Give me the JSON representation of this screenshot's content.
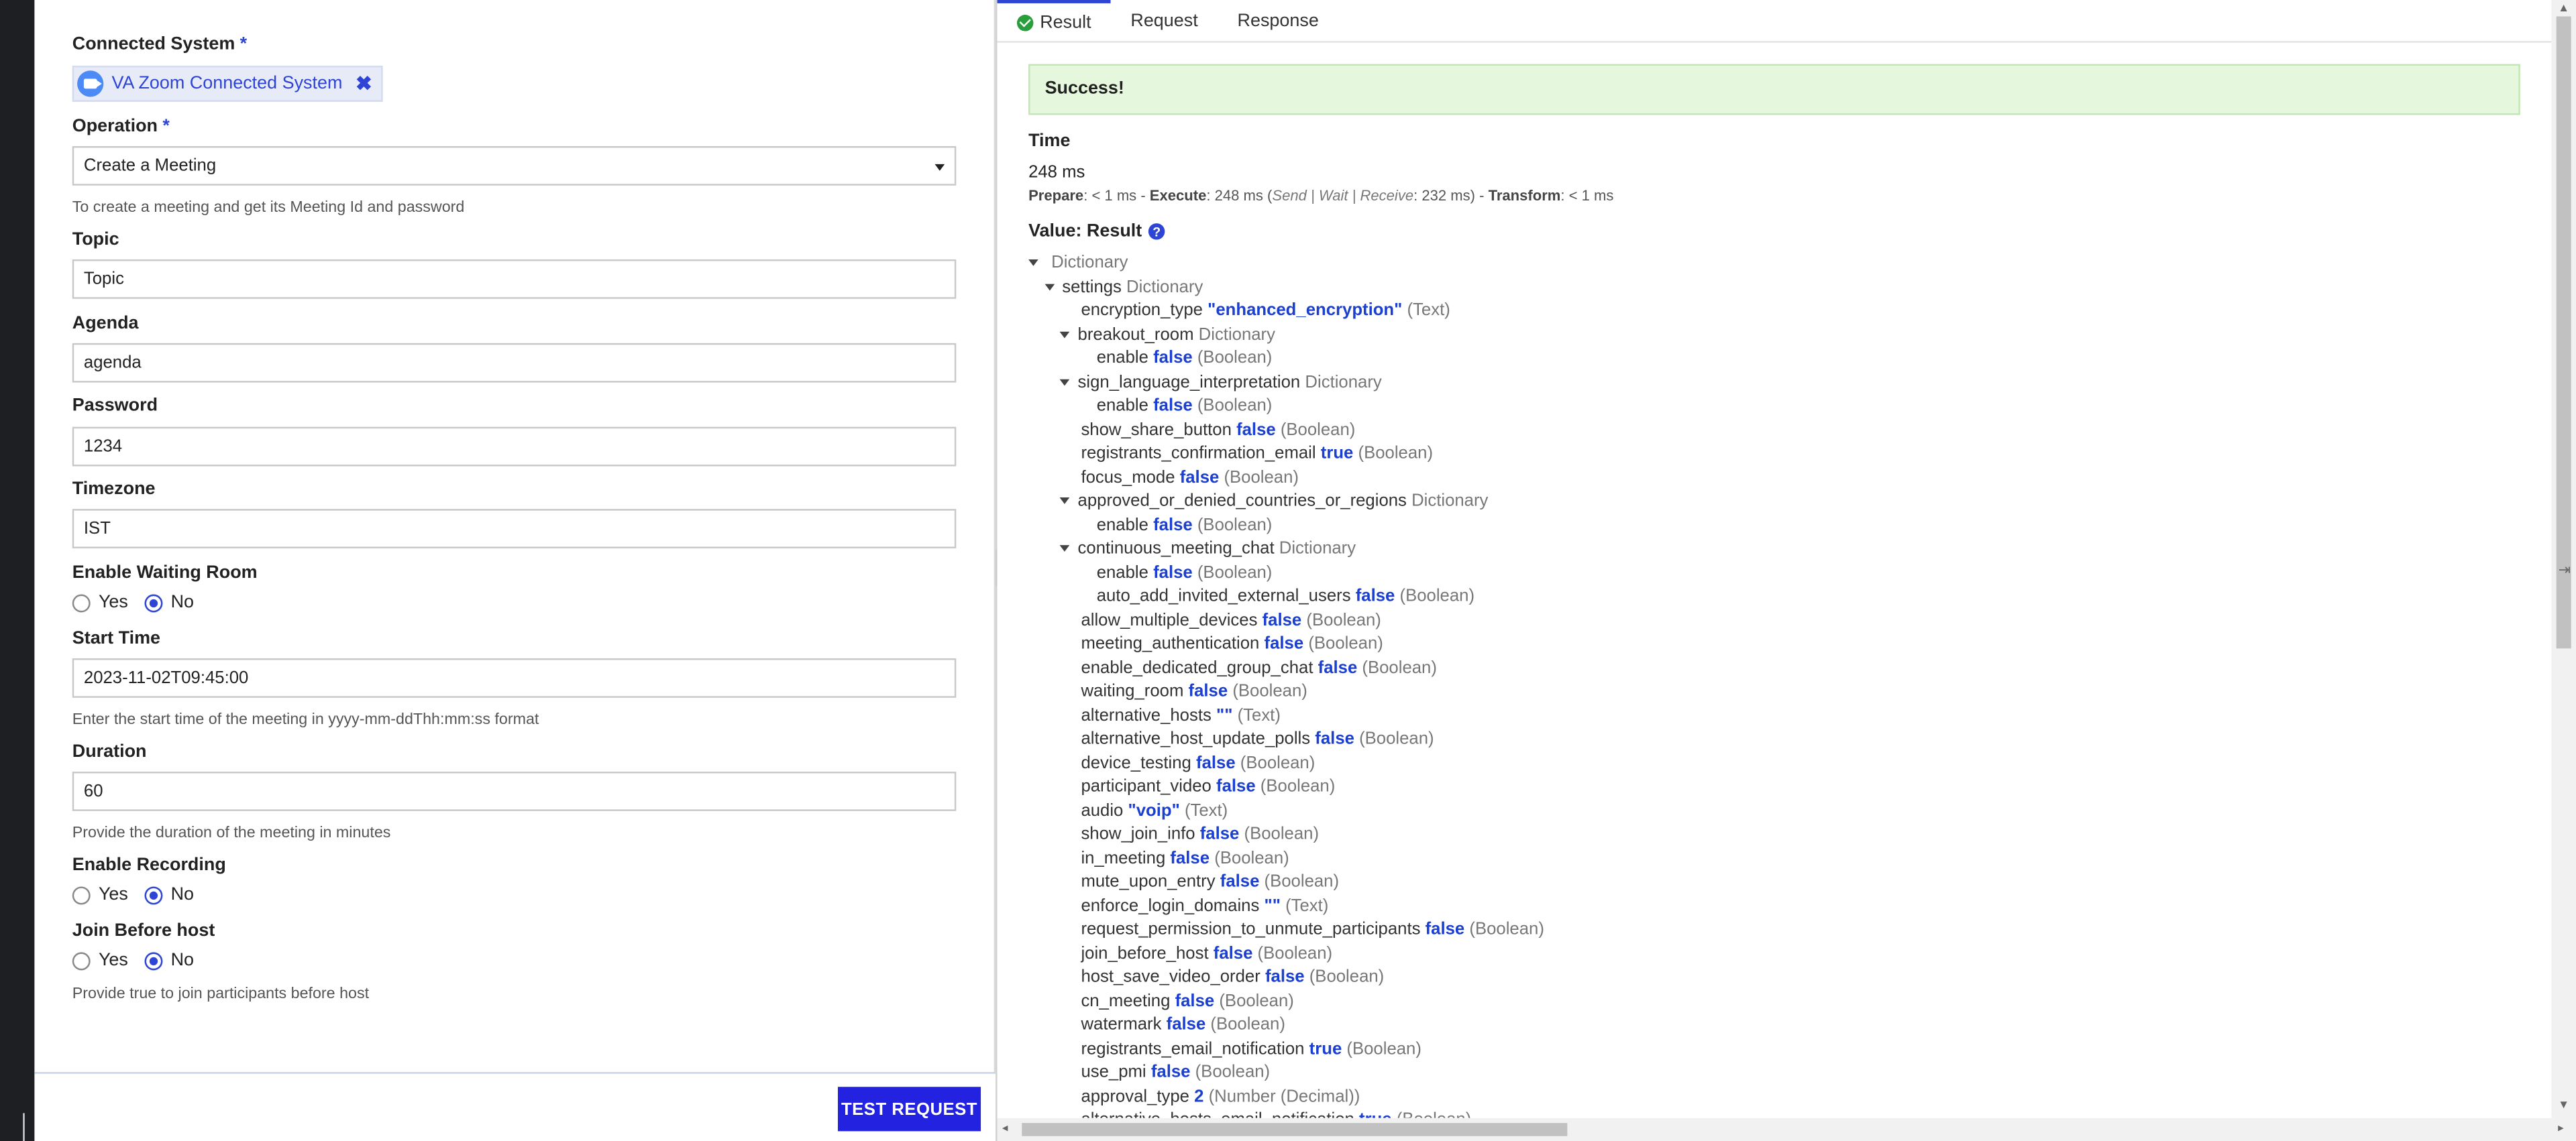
{
  "form": {
    "connected_system": {
      "label": "Connected System",
      "required_mark": "*",
      "chip_text": "VA Zoom Connected System",
      "chip_remove": "✖"
    },
    "operation": {
      "label": "Operation",
      "required_mark": "*",
      "value": "Create a Meeting",
      "helper": "To create a meeting and get its Meeting Id and password"
    },
    "topic": {
      "label": "Topic",
      "value": "Topic"
    },
    "agenda": {
      "label": "Agenda",
      "value": "agenda"
    },
    "password": {
      "label": "Password",
      "value": "1234"
    },
    "timezone": {
      "label": "Timezone",
      "value": "IST"
    },
    "waiting_room": {
      "label": "Enable Waiting Room",
      "yes": "Yes",
      "no": "No",
      "selected": "No"
    },
    "start_time": {
      "label": "Start Time",
      "value": "2023-11-02T09:45:00",
      "helper": "Enter the start time of the meeting in yyyy-mm-ddThh:mm:ss format"
    },
    "duration": {
      "label": "Duration",
      "value": "60",
      "helper": "Provide the duration of the meeting in minutes"
    },
    "recording": {
      "label": "Enable Recording",
      "yes": "Yes",
      "no": "No",
      "selected": "No"
    },
    "join_before_host": {
      "label": "Join Before host",
      "yes": "Yes",
      "no": "No",
      "selected": "No",
      "helper": "Provide true to join participants before host"
    }
  },
  "footer": {
    "test_button": "TEST REQUEST"
  },
  "tabs": {
    "result": "Result",
    "request": "Request",
    "response": "Response"
  },
  "result": {
    "banner": "Success!",
    "time_label": "Time",
    "time_value": "248 ms",
    "timing": {
      "prepare_label": "Prepare",
      "prepare_value": ": < 1 ms - ",
      "execute_label": "Execute",
      "execute_value": ": 248 ms (",
      "swr_label": "Send | Wait | Receive",
      "swr_value": ": 232 ms) - ",
      "transform_label": "Transform",
      "transform_value": ": < 1 ms"
    },
    "value_label": "Value: Result",
    "help_glyph": "?"
  },
  "tree": [
    {
      "key": "",
      "type": "Dictionary",
      "collapsible": true
    },
    {
      "key": "settings",
      "type": "Dictionary",
      "collapsible": true
    },
    {
      "key": "encryption_type",
      "value": "\"enhanced_encryption\"",
      "type": "(Text)"
    },
    {
      "key": "breakout_room",
      "type": "Dictionary",
      "collapsible": true
    },
    {
      "key": "enable",
      "value": "false",
      "type": "(Boolean)"
    },
    {
      "key": "sign_language_interpretation",
      "type": "Dictionary",
      "collapsible": true
    },
    {
      "key": "enable",
      "value": "false",
      "type": "(Boolean)"
    },
    {
      "key": "show_share_button",
      "value": "false",
      "type": "(Boolean)"
    },
    {
      "key": "registrants_confirmation_email",
      "value": "true",
      "type": "(Boolean)"
    },
    {
      "key": "focus_mode",
      "value": "false",
      "type": "(Boolean)"
    },
    {
      "key": "approved_or_denied_countries_or_regions",
      "type": "Dictionary",
      "collapsible": true
    },
    {
      "key": "enable",
      "value": "false",
      "type": "(Boolean)"
    },
    {
      "key": "continuous_meeting_chat",
      "type": "Dictionary",
      "collapsible": true
    },
    {
      "key": "enable",
      "value": "false",
      "type": "(Boolean)"
    },
    {
      "key": "auto_add_invited_external_users",
      "value": "false",
      "type": "(Boolean)"
    },
    {
      "key": "allow_multiple_devices",
      "value": "false",
      "type": "(Boolean)"
    },
    {
      "key": "meeting_authentication",
      "value": "false",
      "type": "(Boolean)"
    },
    {
      "key": "enable_dedicated_group_chat",
      "value": "false",
      "type": "(Boolean)"
    },
    {
      "key": "waiting_room",
      "value": "false",
      "type": "(Boolean)"
    },
    {
      "key": "alternative_hosts",
      "value": "\"\"",
      "type": "(Text)"
    },
    {
      "key": "alternative_host_update_polls",
      "value": "false",
      "type": "(Boolean)"
    },
    {
      "key": "device_testing",
      "value": "false",
      "type": "(Boolean)"
    },
    {
      "key": "participant_video",
      "value": "false",
      "type": "(Boolean)"
    },
    {
      "key": "audio",
      "value": "\"voip\"",
      "type": "(Text)"
    },
    {
      "key": "show_join_info",
      "value": "false",
      "type": "(Boolean)"
    },
    {
      "key": "in_meeting",
      "value": "false",
      "type": "(Boolean)"
    },
    {
      "key": "mute_upon_entry",
      "value": "false",
      "type": "(Boolean)"
    },
    {
      "key": "enforce_login_domains",
      "value": "\"\"",
      "type": "(Text)"
    },
    {
      "key": "request_permission_to_unmute_participants",
      "value": "false",
      "type": "(Boolean)"
    },
    {
      "key": "join_before_host",
      "value": "false",
      "type": "(Boolean)"
    },
    {
      "key": "host_save_video_order",
      "value": "false",
      "type": "(Boolean)"
    },
    {
      "key": "cn_meeting",
      "value": "false",
      "type": "(Boolean)"
    },
    {
      "key": "watermark",
      "value": "false",
      "type": "(Boolean)"
    },
    {
      "key": "registrants_email_notification",
      "value": "true",
      "type": "(Boolean)"
    },
    {
      "key": "use_pmi",
      "value": "false",
      "type": "(Boolean)"
    },
    {
      "key": "approval_type",
      "value": "2",
      "type": "(Number (Decimal))"
    },
    {
      "key": "alternative_hosts_email_notification",
      "value": "true",
      "type": "(Boolean)"
    }
  ],
  "icons": {
    "left_arrow": "◂",
    "right_arrow": "▸",
    "up_arrow": "▲",
    "down_arrow": "▼",
    "collapse": "⇤",
    "expand": "⇥"
  },
  "colors": {
    "accent": "#2e44d4",
    "button": "#2222e0",
    "success_bg": "#e5f8dd",
    "value_blue": "#1a3fd1"
  }
}
